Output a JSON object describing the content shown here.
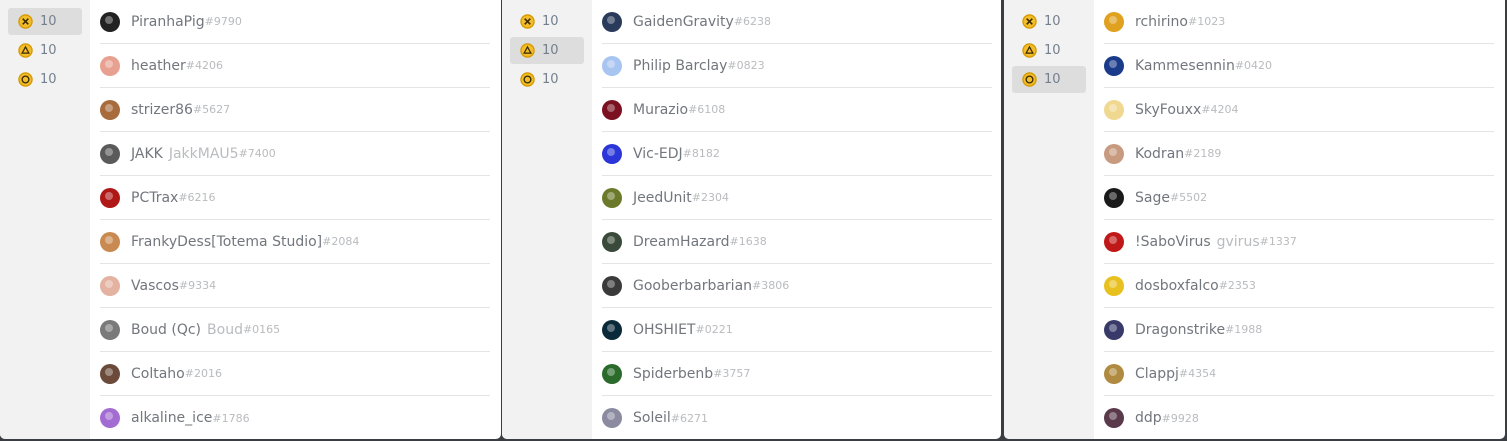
{
  "colors": {
    "reaction_ring": "#d59a00",
    "reaction_fill": "#f3bc2a",
    "active_bg": "#dddddd",
    "sidebar_bg": "#f2f2f2",
    "name_text": "#72767d",
    "tag_text": "#b9bbbe"
  },
  "panels": [
    {
      "reactions": [
        {
          "icon": "cross-button-icon",
          "count": "10",
          "active": true
        },
        {
          "icon": "triangle-button-icon",
          "count": "10",
          "active": false
        },
        {
          "icon": "circle-button-icon",
          "count": "10",
          "active": false
        }
      ],
      "users": [
        {
          "name": "PiranhaPig",
          "alt": "",
          "tag": "#9790",
          "avatar_color": "#222222"
        },
        {
          "name": "heather",
          "alt": "",
          "tag": "#4206",
          "avatar_color": "#e8a090"
        },
        {
          "name": "strizer86",
          "alt": "",
          "tag": "#5627",
          "avatar_color": "#a86b3c"
        },
        {
          "name": "JAKK",
          "alt": "JakkMAU5",
          "tag": "#7400",
          "avatar_color": "#5a5a5a"
        },
        {
          "name": "PCTrax",
          "alt": "",
          "tag": "#6216",
          "avatar_color": "#b01818"
        },
        {
          "name": "FrankyDess[Totema Studio]",
          "alt": "",
          "tag": "#2084",
          "avatar_color": "#c98a52"
        },
        {
          "name": "Vascos",
          "alt": "",
          "tag": "#9334",
          "avatar_color": "#e4b2a0"
        },
        {
          "name": "Boud (Qc)",
          "alt": "Boud",
          "tag": "#0165",
          "avatar_color": "#7a7a7a"
        },
        {
          "name": "Coltaho",
          "alt": "",
          "tag": "#2016",
          "avatar_color": "#6b4a3a"
        },
        {
          "name": "alkaline_ice",
          "alt": "",
          "tag": "#1786",
          "avatar_color": "#a36cd2"
        }
      ]
    },
    {
      "reactions": [
        {
          "icon": "cross-button-icon",
          "count": "10",
          "active": false
        },
        {
          "icon": "triangle-button-icon",
          "count": "10",
          "active": true
        },
        {
          "icon": "circle-button-icon",
          "count": "10",
          "active": false
        }
      ],
      "users": [
        {
          "name": "GaidenGravity",
          "alt": "",
          "tag": "#6238",
          "avatar_color": "#2a3a5a"
        },
        {
          "name": "Philip Barclay",
          "alt": "",
          "tag": "#0823",
          "avatar_color": "#a8c4f0"
        },
        {
          "name": "Murazio",
          "alt": "",
          "tag": "#6108",
          "avatar_color": "#7a1020"
        },
        {
          "name": "Vic-EDJ",
          "alt": "",
          "tag": "#8182",
          "avatar_color": "#2a36d8"
        },
        {
          "name": "JeedUnit",
          "alt": "",
          "tag": "#2304",
          "avatar_color": "#6a7a2a"
        },
        {
          "name": "DreamHazard",
          "alt": "",
          "tag": "#1638",
          "avatar_color": "#3a4a3a"
        },
        {
          "name": "Gooberbarbarian",
          "alt": "",
          "tag": "#3806",
          "avatar_color": "#3a3a3a"
        },
        {
          "name": "OHSHIET",
          "alt": "",
          "tag": "#0221",
          "avatar_color": "#0a2a3a"
        },
        {
          "name": "Spiderbenb",
          "alt": "",
          "tag": "#3757",
          "avatar_color": "#2a6a2a"
        },
        {
          "name": "Soleil",
          "alt": "",
          "tag": "#6271",
          "avatar_color": "#8a8aa0"
        }
      ]
    },
    {
      "reactions": [
        {
          "icon": "cross-button-icon",
          "count": "10",
          "active": false
        },
        {
          "icon": "triangle-button-icon",
          "count": "10",
          "active": false
        },
        {
          "icon": "circle-button-icon",
          "count": "10",
          "active": true
        }
      ],
      "users": [
        {
          "name": "rchirino",
          "alt": "",
          "tag": "#1023",
          "avatar_color": "#e0a020"
        },
        {
          "name": "Kammesennin",
          "alt": "",
          "tag": "#0420",
          "avatar_color": "#1a3a8a"
        },
        {
          "name": "SkyFouxx",
          "alt": "",
          "tag": "#4204",
          "avatar_color": "#f0d890"
        },
        {
          "name": "Kodran",
          "alt": "",
          "tag": "#2189",
          "avatar_color": "#c89a80"
        },
        {
          "name": "Sage",
          "alt": "",
          "tag": "#5502",
          "avatar_color": "#1a1a1a"
        },
        {
          "name": "!SaboVirus",
          "alt": "gvirus",
          "tag": "#1337",
          "avatar_color": "#c01818"
        },
        {
          "name": "dosboxfalco",
          "alt": "",
          "tag": "#2353",
          "avatar_color": "#e8c020"
        },
        {
          "name": "Dragonstrike",
          "alt": "",
          "tag": "#1988",
          "avatar_color": "#3a3a6a"
        },
        {
          "name": "Clappj",
          "alt": "",
          "tag": "#4354",
          "avatar_color": "#b08a40"
        },
        {
          "name": "ddp",
          "alt": "",
          "tag": "#9928",
          "avatar_color": "#5a3a4a"
        }
      ]
    }
  ]
}
